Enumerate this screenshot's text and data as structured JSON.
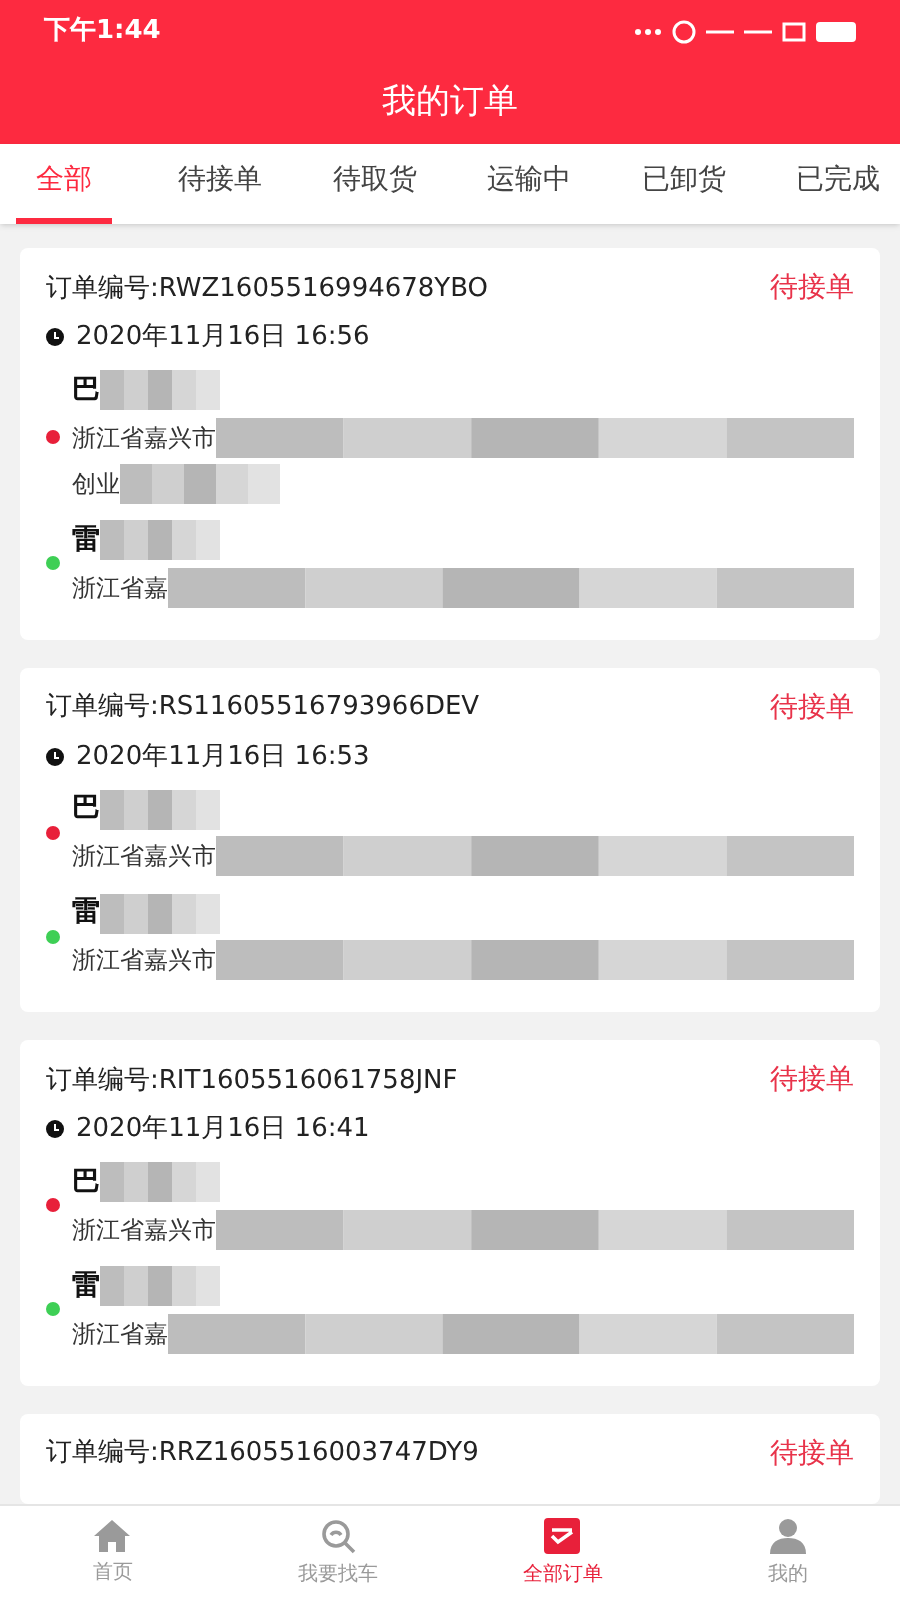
{
  "status_bar": {
    "time": "下午1:44"
  },
  "header": {
    "title": "我的订单"
  },
  "tabs": [
    {
      "label": "全部",
      "selected": true
    },
    {
      "label": "待接单",
      "selected": false
    },
    {
      "label": "待取货",
      "selected": false
    },
    {
      "label": "运输中",
      "selected": false
    },
    {
      "label": "已卸货",
      "selected": false
    },
    {
      "label": "已完成",
      "selected": false
    }
  ],
  "orders": [
    {
      "number": "订单编号:RWZ1605516994678YBO",
      "status": "待接单",
      "time": "2020年11月16日 16:56",
      "sender": {
        "name": "巴",
        "address": [
          "浙江省嘉兴市",
          "创业"
        ]
      },
      "receiver": {
        "name": "雷",
        "address": [
          "浙江省嘉"
        ]
      }
    },
    {
      "number": "订单编号:RS11605516793966DEV",
      "status": "待接单",
      "time": "2020年11月16日 16:53",
      "sender": {
        "name": "巴",
        "address": [
          "浙江省嘉兴市"
        ]
      },
      "receiver": {
        "name": "雷",
        "address": [
          "浙江省嘉兴市"
        ]
      }
    },
    {
      "number": "订单编号:RIT1605516061758JNF",
      "status": "待接单",
      "time": "2020年11月16日 16:41",
      "sender": {
        "name": "巴",
        "address": [
          "浙江省嘉兴市"
        ]
      },
      "receiver": {
        "name": "雷",
        "address": [
          "浙江省嘉"
        ]
      }
    },
    {
      "number": "订单编号:RRZ1605516003747DY9",
      "status": "待接单"
    }
  ],
  "bottom_nav": [
    {
      "label": "首页",
      "kind": "home",
      "selected": false
    },
    {
      "label": "我要找车",
      "kind": "search",
      "selected": false
    },
    {
      "label": "全部订单",
      "kind": "orders",
      "selected": true
    },
    {
      "label": "我的",
      "kind": "profile",
      "selected": false
    }
  ]
}
